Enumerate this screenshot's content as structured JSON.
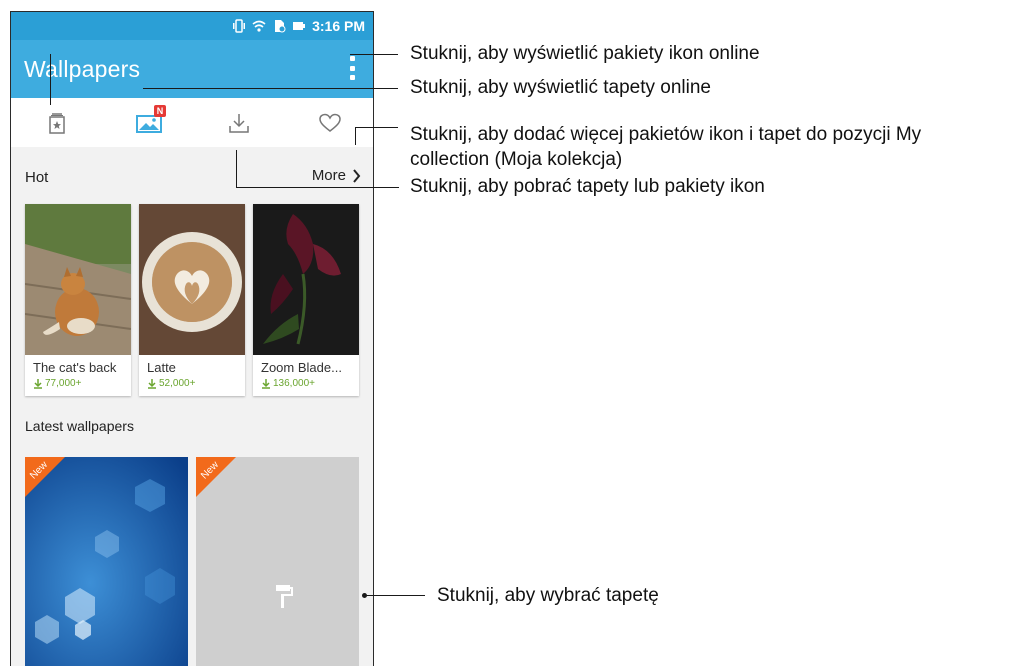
{
  "status_bar": {
    "time": "3:16 PM"
  },
  "app": {
    "title": "Wallpapers"
  },
  "tabs": [
    {
      "icon": "icon-pack-icon"
    },
    {
      "icon": "wallpaper-image-icon",
      "badge": "N"
    },
    {
      "icon": "download-icon"
    },
    {
      "icon": "heart-icon"
    }
  ],
  "hot": {
    "title": "Hot",
    "more_label": "More",
    "items": [
      {
        "name": "The cat's back",
        "downloads": "77,000+"
      },
      {
        "name": "Latte",
        "downloads": "52,000+"
      },
      {
        "name": "Zoom Blade...",
        "downloads": "136,000+"
      }
    ]
  },
  "latest": {
    "title": "Latest wallpapers",
    "items": [
      {
        "ribbon": "New"
      },
      {
        "ribbon": "New"
      }
    ]
  },
  "callouts": {
    "icon_packs": "Stuknij, aby wyświetlić pakiety ikon online",
    "wallpapers": "Stuknij, aby wyświetlić tapety online",
    "collection_line1": "Stuknij, aby dodać więcej pakietów ikon i tapet do pozycji My",
    "collection_line2": "collection (Moja kolekcja)",
    "download": "Stuknij, aby pobrać tapety lub pakiety ikon",
    "select": "Stuknij, aby wybrać tapetę"
  },
  "colors": {
    "status_bar": "#2b9fd6",
    "app_bar": "#3eacdf",
    "accent": "#3eacdf",
    "download_green": "#6aa52f",
    "new_ribbon": "#f26a1b"
  }
}
